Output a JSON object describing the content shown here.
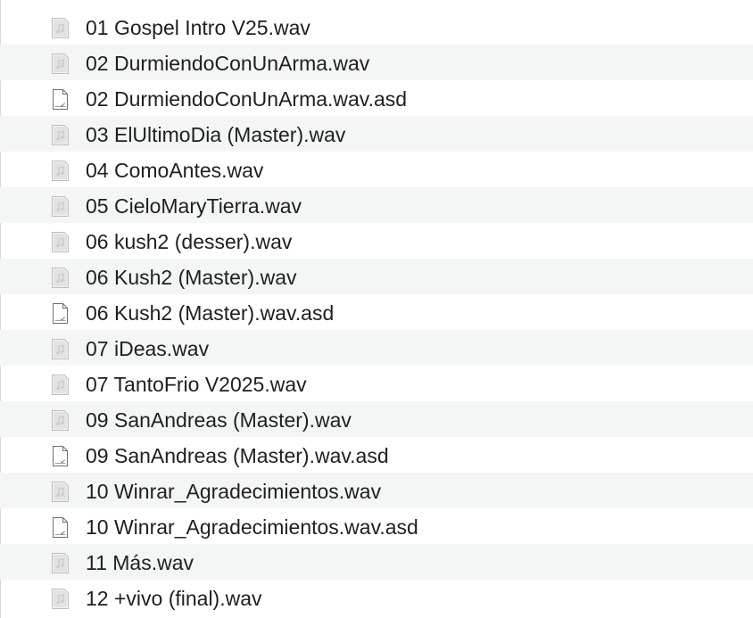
{
  "files": [
    {
      "name": "01 Gospel Intro V25.wav",
      "icon": "audio-file-icon"
    },
    {
      "name": "02 DurmiendoConUnArma.wav",
      "icon": "audio-file-icon"
    },
    {
      "name": "02 DurmiendoConUnArma.wav.asd",
      "icon": "document-file-icon"
    },
    {
      "name": "03 ElUltimoDia (Master).wav",
      "icon": "audio-file-icon"
    },
    {
      "name": "04 ComoAntes.wav",
      "icon": "audio-file-icon"
    },
    {
      "name": "05 CieloMaryTierra.wav",
      "icon": "audio-file-icon"
    },
    {
      "name": "06 kush2 (desser).wav",
      "icon": "audio-file-icon"
    },
    {
      "name": "06 Kush2 (Master).wav",
      "icon": "audio-file-icon"
    },
    {
      "name": "06 Kush2 (Master).wav.asd",
      "icon": "document-file-icon"
    },
    {
      "name": "07 iDeas.wav",
      "icon": "audio-file-icon"
    },
    {
      "name": "07 TantoFrio V2025.wav",
      "icon": "audio-file-icon"
    },
    {
      "name": "09 SanAndreas (Master).wav",
      "icon": "audio-file-icon"
    },
    {
      "name": "09 SanAndreas (Master).wav.asd",
      "icon": "document-file-icon"
    },
    {
      "name": "10 Winrar_Agradecimientos.wav",
      "icon": "audio-file-icon"
    },
    {
      "name": "10 Winrar_Agradecimientos.wav.asd",
      "icon": "document-file-icon"
    },
    {
      "name": "11 Más.wav",
      "icon": "audio-file-icon"
    },
    {
      "name": "12 +vivo (final).wav",
      "icon": "audio-file-icon"
    }
  ]
}
